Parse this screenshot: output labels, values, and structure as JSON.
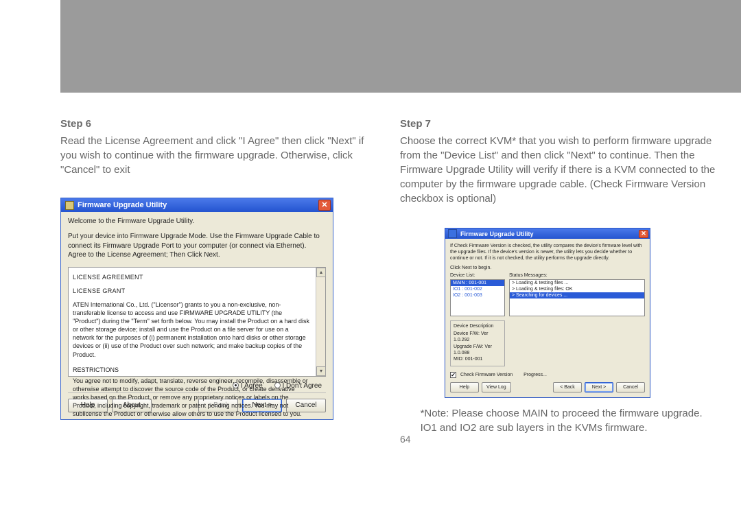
{
  "page_number": "64",
  "left": {
    "step_label": "Step 6",
    "text": "Read the License Agreement and click \"I Agree\" then click \"Next\" if you wish to continue with the firmware upgrade. Otherwise, click \"Cancel\" to exit"
  },
  "right": {
    "step_label": "Step 7",
    "text": "Choose the correct KVM* that you wish to perform firmware upgrade from the \"Device List\" and then click \"Next\" to continue. Then the Firmware Upgrade Utility will verify if there is a KVM connected to the computer by the firmware upgrade cable. (Check Firmware Version checkbox is optional)",
    "footnote": "*Note: Please choose MAIN to proceed the firmware upgrade. IO1 and IO2 are sub layers in the KVMs firmware."
  },
  "dlg1": {
    "title": "Firmware Upgrade Utility",
    "welcome": "Welcome to the Firmware Upgrade Utility.",
    "instructions": "Put your device into Firmware Upgrade Mode. Use the Firmware Upgrade Cable to connect its Firmware Upgrade Port to your computer (or connect via Ethernet). Agree to the License Agreement; Then Click Next.",
    "lic_heading": "LICENSE AGREEMENT",
    "lic_grant_h": "LICENSE GRANT",
    "lic_grant": "ATEN International Co., Ltd. (\"Licensor\") grants to you a non-exclusive, non-transferable license to access and use FIRMWARE UPGRADE UTILITY (the \"Product\") during the \"Term\" set forth below. You may install the Product on a hard disk or other storage device; install and use the Product on a file server for use on a network for the purposes of (i) permanent installation onto hard disks or other storage devices or (ii) use of the Product over such network; and make backup copies of the Product.",
    "lic_restr_h": "RESTRICTIONS",
    "lic_restr": "You agree not to modify, adapt, translate, reverse engineer, recompile, disassemble or otherwise attempt to discover the source code of the Product, or create derivative works based on the Product, or remove any proprietary notices or labels on the Product, including copyright, trademark or patent pending notices. You may not sublicense the Product or otherwise allow others to use the Product licensed to you.",
    "radio_agree": "I Agree",
    "radio_dont": "I Don't Agree",
    "btn_help": "Help",
    "btn_about": "About",
    "btn_back": "< Back",
    "btn_next": "Next >",
    "btn_cancel": "Cancel"
  },
  "dlg2": {
    "title": "Firmware Upgrade Utility",
    "top": "If Check Firmware Version is checked, the utility compares the device's firmware level with the upgrade files. If the device's version is newer, the utility lets you decide whether to continue or not. If it is not checked, the utility performs the upgrade directly.",
    "clicknext": "Click Next to begin.",
    "device_list_label": "Device List:",
    "status_label": "Status Messages:",
    "devices": [
      "MAIN : 001-001",
      "IO1 : 001-002",
      "IO2 : 001-003"
    ],
    "status": [
      "> Loading & testing files ...",
      "> Loading & testing files: OK",
      "> Searching for devices ..."
    ],
    "desc_title": "Device Description",
    "desc_lines": [
      "Device F/W: Ver 1.0.292",
      "Upgrade F/W: Ver 1.0.088",
      "MID: 001-001"
    ],
    "check_label": "Check Firmware Version",
    "progress_label": "Progress...",
    "btn_help": "Help",
    "btn_viewlog": "View Log",
    "btn_back": "< Back",
    "btn_next": "Next >",
    "btn_cancel": "Cancel"
  }
}
